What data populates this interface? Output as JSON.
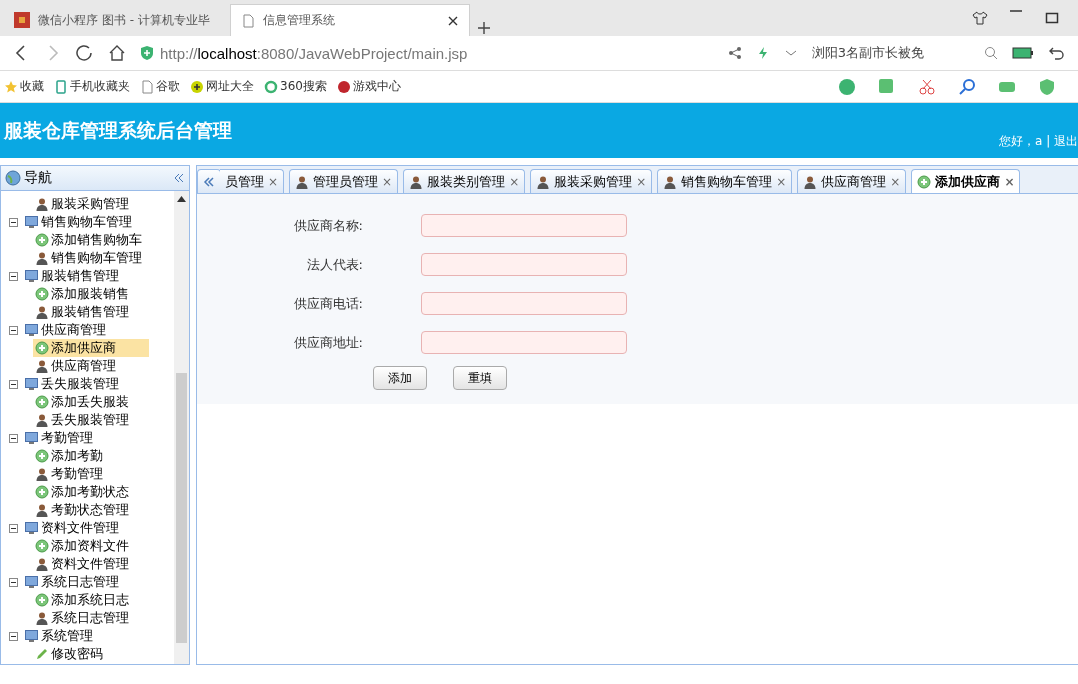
{
  "browser": {
    "tabs": [
      {
        "title": "微信小程序 图书 - 计算机专业毕",
        "selected": false,
        "kind": "app"
      },
      {
        "title": "信息管理系统",
        "selected": true,
        "kind": "page"
      }
    ],
    "url": {
      "scheme": "http://",
      "host": "localhost",
      "rest": ":8080/JavaWebProject/main.jsp"
    },
    "news_text": "浏阳3名副市长被免",
    "bookmarks": [
      {
        "label": "收藏",
        "kind": "star"
      },
      {
        "label": "手机收藏夹",
        "kind": "phone"
      },
      {
        "label": "谷歌",
        "kind": "page"
      },
      {
        "label": "网址大全",
        "kind": "plus"
      },
      {
        "label": "360搜索",
        "kind": "ring"
      },
      {
        "label": "游戏中心",
        "kind": "game"
      }
    ]
  },
  "header": {
    "title": "服装仓库管理系统后台管理",
    "greeting": "您好，a | 退出"
  },
  "sidebar": {
    "title": "导航",
    "tree": [
      {
        "label": "服装采购管理",
        "kind": "manage",
        "selected": false
      },
      {
        "label": "销售购物车管理",
        "kind": "folder",
        "expanded": true,
        "children": [
          {
            "label": "添加销售购物车",
            "kind": "add",
            "selected": false
          },
          {
            "label": "销售购物车管理",
            "kind": "manage",
            "selected": false
          }
        ]
      },
      {
        "label": "服装销售管理",
        "kind": "folder",
        "expanded": true,
        "children": [
          {
            "label": "添加服装销售",
            "kind": "add",
            "selected": false
          },
          {
            "label": "服装销售管理",
            "kind": "manage",
            "selected": false
          }
        ]
      },
      {
        "label": "供应商管理",
        "kind": "folder",
        "expanded": true,
        "children": [
          {
            "label": "添加供应商",
            "kind": "add",
            "selected": true
          },
          {
            "label": "供应商管理",
            "kind": "manage",
            "selected": false
          }
        ]
      },
      {
        "label": "丢失服装管理",
        "kind": "folder",
        "expanded": true,
        "children": [
          {
            "label": "添加丢失服装",
            "kind": "add",
            "selected": false
          },
          {
            "label": "丢失服装管理",
            "kind": "manage",
            "selected": false
          }
        ]
      },
      {
        "label": "考勤管理",
        "kind": "folder",
        "expanded": true,
        "children": [
          {
            "label": "添加考勤",
            "kind": "add",
            "selected": false
          },
          {
            "label": "考勤管理",
            "kind": "manage",
            "selected": false
          },
          {
            "label": "添加考勤状态",
            "kind": "add",
            "selected": false
          },
          {
            "label": "考勤状态管理",
            "kind": "manage",
            "selected": false
          }
        ]
      },
      {
        "label": "资料文件管理",
        "kind": "folder",
        "expanded": true,
        "children": [
          {
            "label": "添加资料文件",
            "kind": "add",
            "selected": false
          },
          {
            "label": "资料文件管理",
            "kind": "manage",
            "selected": false
          }
        ]
      },
      {
        "label": "系统日志管理",
        "kind": "folder",
        "expanded": true,
        "children": [
          {
            "label": "添加系统日志",
            "kind": "add",
            "selected": false
          },
          {
            "label": "系统日志管理",
            "kind": "manage",
            "selected": false
          }
        ]
      },
      {
        "label": "系统管理",
        "kind": "folder",
        "expanded": true,
        "children": [
          {
            "label": "修改密码",
            "kind": "edit",
            "selected": false
          }
        ]
      }
    ]
  },
  "tabs": [
    {
      "label": "员管理",
      "close": "×",
      "selected": false,
      "clipped": true
    },
    {
      "label": "管理员管理",
      "kind": "manage",
      "close": "×",
      "selected": false
    },
    {
      "label": "服装类别管理",
      "kind": "manage",
      "close": "×",
      "selected": false
    },
    {
      "label": "服装采购管理",
      "kind": "manage",
      "close": "×",
      "selected": false
    },
    {
      "label": "销售购物车管理",
      "kind": "manage",
      "close": "×",
      "selected": false
    },
    {
      "label": "供应商管理",
      "kind": "manage",
      "close": "×",
      "selected": false
    },
    {
      "label": "添加供应商",
      "kind": "add",
      "close": "×",
      "selected": true
    }
  ],
  "form": {
    "fields": [
      {
        "label": "供应商名称:"
      },
      {
        "label": "法人代表:"
      },
      {
        "label": "供应商电话:"
      },
      {
        "label": "供应商地址:"
      }
    ],
    "buttons": [
      "添加",
      "重填"
    ]
  }
}
